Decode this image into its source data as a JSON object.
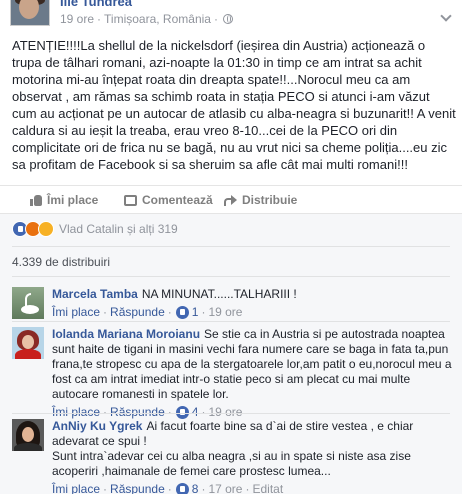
{
  "post": {
    "author": "Ille Tundrea",
    "time": "19 ore",
    "location": "Timișoara, România",
    "text": "ATENȚIE!!!!La shellul de la nickelsdorf (ieșirea din Austria) acționează o trupa de tâlhari romani, azi-noapte la 01:30 in timp ce am intrat sa achit motorina mi-au înțepat roata din dreapta spate!!...Norocul meu ca am observat , am rămas sa schimb roata in stația PECO si atunci i-am văzut cum au acționat pe un autocar de atlasib cu alba-neagra si buzunarit!! A venit caldura si au ieșit la treaba, erau vreo 8-10...cei de la PECO ori din complicitate ori de frica nu se bagă, nu au vrut nici sa cheme poliția....eu zic sa profitam de Facebook si sa sheruim sa afle cât mai multi romani!!!"
  },
  "actions": {
    "like": "Îmi place",
    "comment": "Comentează",
    "share": "Distribuie"
  },
  "reactions": {
    "label": "Vlad Catalin și alți 319"
  },
  "shares": "4.339 de distribuiri",
  "comments": [
    {
      "name": "Marcela Tamba",
      "text": "NA MINUNAT......TALHARIII !",
      "like": "Îmi place",
      "reply": "Răspunde",
      "likes": "1",
      "time": "19 ore"
    },
    {
      "name": "Iolanda Mariana Moroianu",
      "text": "Se stie ca in Austria si pe autostrada noaptea sunt haite de tigani in masini vechi fara numere care se baga in fata ta,pun frana,te stropesc cu apa de la stergatoarele lor,am patit o eu,norocul meu a fost ca am intrat imediat intr-o statie peco si am plecat cu mai multe autocare romanesti in spatele lor.",
      "like": "Îmi place",
      "reply": "Răspunde",
      "likes": "4",
      "time": "19 ore"
    },
    {
      "name": "AnNiy Ku Ygrek",
      "text_line1": "Ai facut foarte bine sa d`ai de stire vestea , e chiar adevarat ce spui !",
      "text_line2": "Sunt intra`adevar cei cu alba neagra ,si au in spate si niste asa zise acoperiri ,haimanale de femei care prostesc lumea...",
      "like": "Îmi place",
      "reply": "Răspunde",
      "likes": "8",
      "time": "17 ore",
      "edited": "Editat"
    }
  ]
}
